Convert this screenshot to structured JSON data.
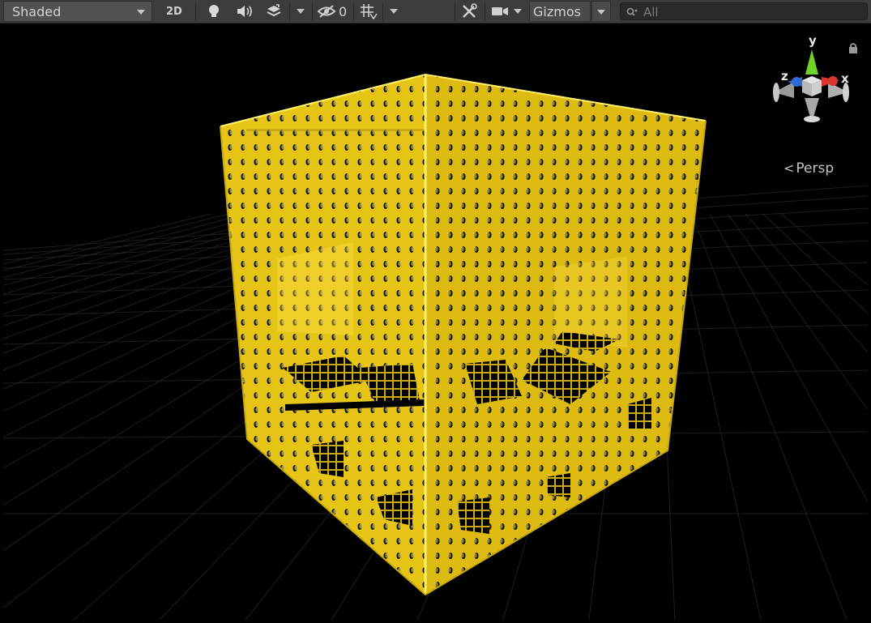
{
  "toolbar": {
    "shading_mode": "Shaded",
    "mode_2d_label": "2D",
    "hidden_objects_count": "0",
    "gizmos_label": "Gizmos",
    "search_placeholder": "All"
  },
  "gizmo": {
    "x_label": "x",
    "y_label": "y",
    "z_label": "z",
    "projection_label": "Persp"
  },
  "colors": {
    "toolbar_bg": "#3c3c3c",
    "viewport_bg": "#000000",
    "grid_line": "#3a3a3a",
    "cube_yellow": "#e8c81a",
    "axis_x": "#d6362c",
    "axis_y": "#6fd22a",
    "axis_z": "#2f6bd8"
  },
  "icons": {
    "shading_dropdown": "chevron-down-icon",
    "lighting": "light-bulb-icon",
    "audio": "speaker-icon",
    "effects": "layers-icon",
    "effects_dropdown": "chevron-down-icon",
    "visibility": "eye-slash-icon",
    "grid": "grid-icon",
    "grid_dropdown": "chevron-down-icon",
    "tools": "tools-icon",
    "camera": "camera-icon",
    "camera_dropdown": "chevron-down-icon",
    "gizmos_dropdown": "chevron-down-icon",
    "search": "search-icon",
    "lock": "lock-icon"
  }
}
